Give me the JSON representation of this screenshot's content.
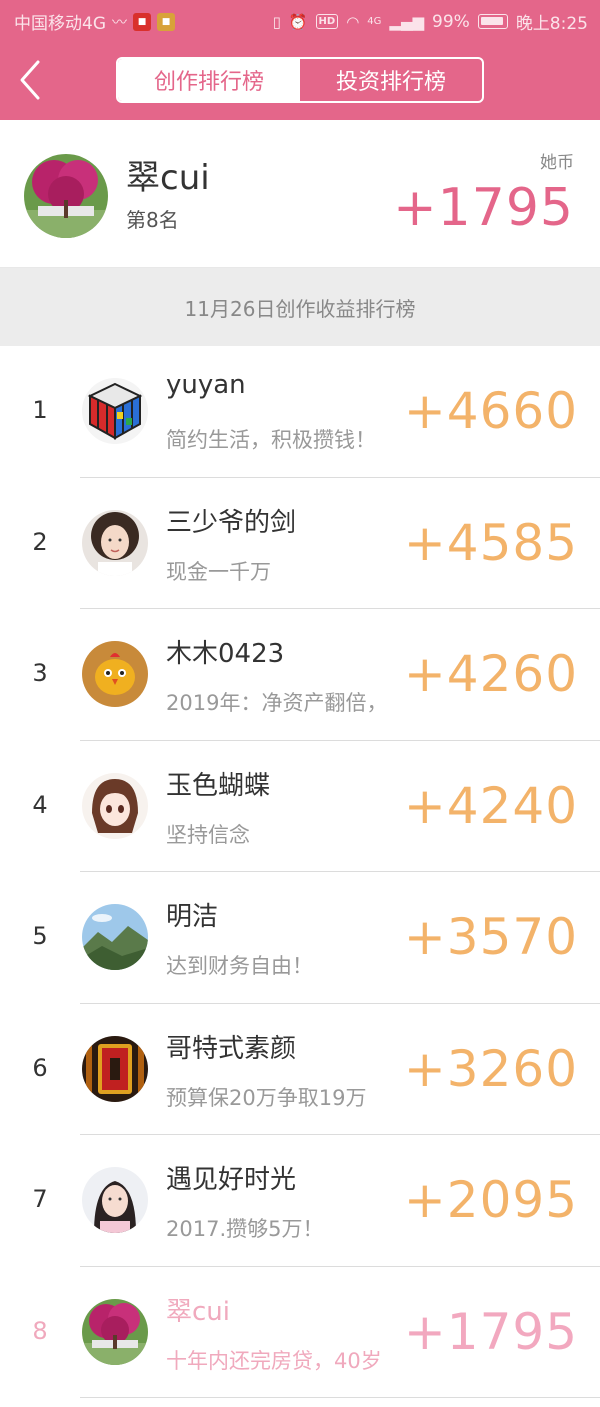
{
  "status_bar": {
    "carrier": "中国移动4G",
    "battery": "99%",
    "time": "晚上8:25",
    "hd": "HD",
    "network": "4G"
  },
  "header": {
    "back_icon": "chevron-left-icon",
    "tabs": [
      {
        "label": "创作排行榜",
        "active": true
      },
      {
        "label": "投资排行榜",
        "active": false
      }
    ],
    "accent_color": "#e4668a"
  },
  "my_rank": {
    "name": "翠cui",
    "rank_text": "第8名",
    "unit": "她币",
    "score": "+1795"
  },
  "banner": {
    "title": "11月26日创作收益排行榜"
  },
  "ranking": [
    {
      "rank": "1",
      "name": "yuyan",
      "motto": "简约生活，积极攒钱！",
      "score": "+4660"
    },
    {
      "rank": "2",
      "name": "三少爷的剑",
      "motto": "现金一千万",
      "score": "+4585"
    },
    {
      "rank": "3",
      "name": "木木0423",
      "motto": "2019年：净资产翻倍，",
      "score": "+4260"
    },
    {
      "rank": "4",
      "name": "玉色蝴蝶",
      "motto": "坚持信念",
      "score": "+4240"
    },
    {
      "rank": "5",
      "name": "明洁",
      "motto": "达到财务自由！",
      "score": "+3570"
    },
    {
      "rank": "6",
      "name": "哥特式素颜",
      "motto": "预算保20万争取19万",
      "score": "+3260"
    },
    {
      "rank": "7",
      "name": "遇见好时光",
      "motto": "2017.攒够5万！",
      "score": "+2095"
    },
    {
      "rank": "8",
      "name": "翠cui",
      "motto": "十年内还完房贷，40岁",
      "score": "+1795"
    }
  ]
}
